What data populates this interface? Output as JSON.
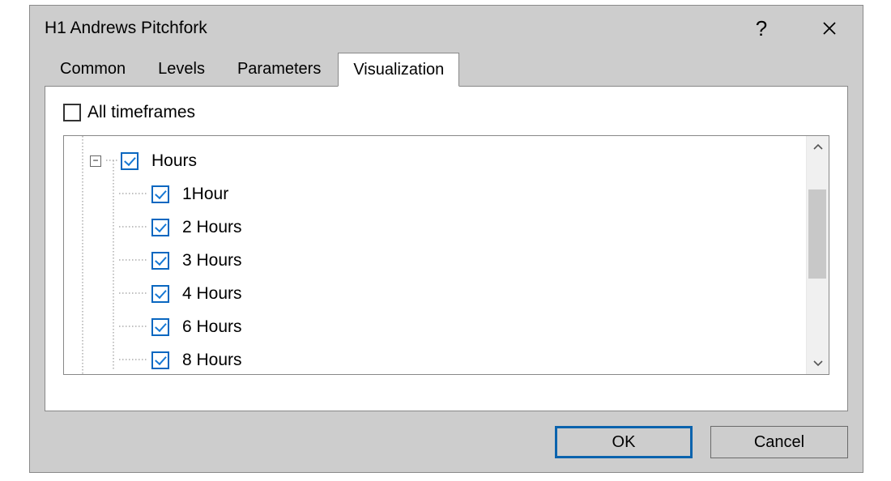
{
  "dialog": {
    "title": "H1 Andrews Pitchfork"
  },
  "tabs": {
    "items": [
      {
        "label": "Common"
      },
      {
        "label": "Levels"
      },
      {
        "label": "Parameters"
      },
      {
        "label": "Visualization"
      }
    ],
    "active_index": 3
  },
  "visualization": {
    "all_timeframes_label": "All timeframes",
    "all_timeframes_checked": false,
    "tree": {
      "group_label": "Hours",
      "group_checked": true,
      "group_expanded": true,
      "items": [
        {
          "label": "1Hour",
          "checked": true
        },
        {
          "label": "2 Hours",
          "checked": true
        },
        {
          "label": "3 Hours",
          "checked": true
        },
        {
          "label": "4 Hours",
          "checked": true
        },
        {
          "label": "6 Hours",
          "checked": true
        },
        {
          "label": "8 Hours",
          "checked": true
        }
      ]
    }
  },
  "buttons": {
    "ok": "OK",
    "cancel": "Cancel"
  }
}
